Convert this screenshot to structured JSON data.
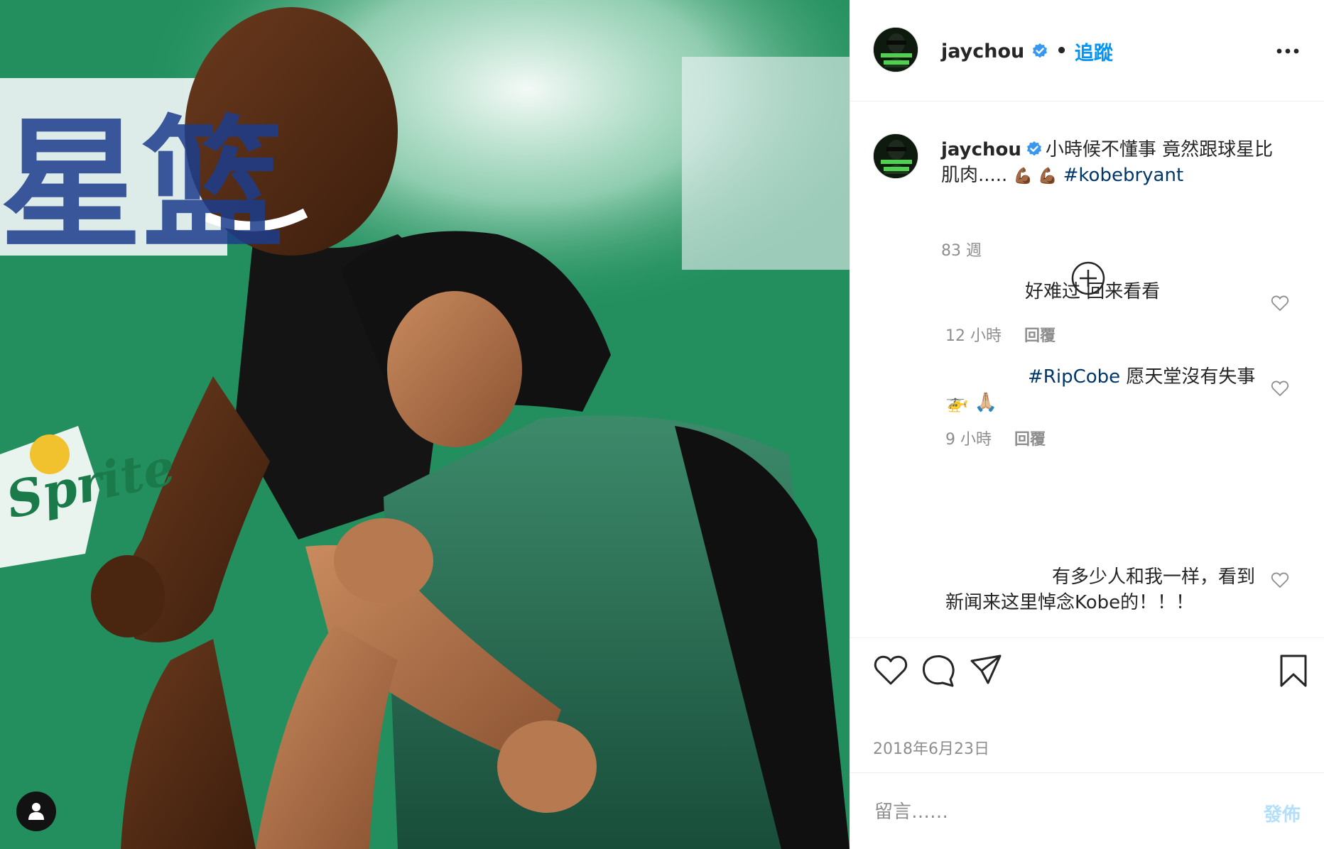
{
  "colors": {
    "accent": "#0095f6",
    "hashtag": "#00376b",
    "muted": "#8e8e8e",
    "text": "#262626",
    "verified": "#3897f0",
    "post_disabled": "#b2dffc"
  },
  "photo": {
    "banner_chars": "星篮",
    "sprite_text": "Sprite",
    "user_tag_icon": "user-icon"
  },
  "header": {
    "username": "jaychou",
    "separator": "•",
    "follow_label": "追蹤",
    "more_icon": "more-horizontal-icon"
  },
  "caption": {
    "username": "jaychou",
    "text": "小時候不懂事 竟然跟球星比肌肉.....",
    "emojis": "💪🏾 💪🏾",
    "hashtag": "#kobebryant",
    "time": "83 週"
  },
  "load_more_icon": "plus-circle-icon",
  "comments": [
    {
      "text": "好难过 回来看看",
      "time": "12 小時",
      "reply": "回覆"
    },
    {
      "hashtag": "#RipCobe",
      "text": "愿天堂沒有失事🚁 🙏🏼",
      "time": "9 小時",
      "reply": "回覆"
    },
    {
      "text": "有多少人和我一样，看到新闻来这里悼念Kobe的！！！"
    }
  ],
  "actions": {
    "icons": [
      "heart-icon",
      "comment-icon",
      "share-icon",
      "bookmark-icon"
    ],
    "date": "2018年6月23日"
  },
  "add_comment": {
    "placeholder": "留言……",
    "post_label": "發佈"
  }
}
